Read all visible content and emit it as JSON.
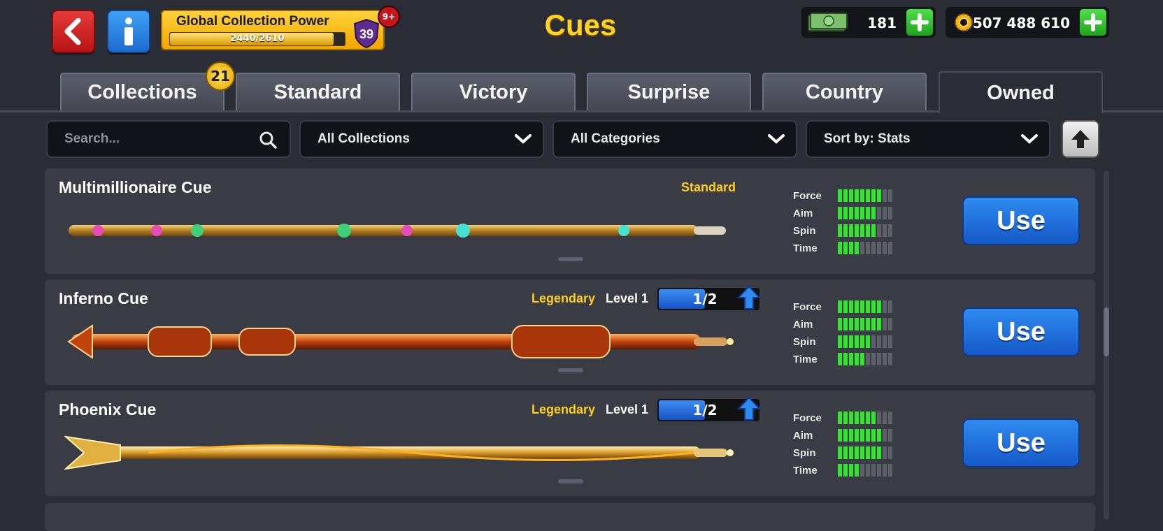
{
  "header": {
    "title": "Cues",
    "collection_power_title": "Global Collection Power",
    "collection_power_progress": "2440/2610",
    "collection_power_fraction": 0.935,
    "collection_level": "39",
    "notification_badge": "9+",
    "cash": "181",
    "coins": "507 488 610"
  },
  "tabs": [
    {
      "label": "Collections",
      "badge": "21",
      "active": false
    },
    {
      "label": "Standard",
      "active": false
    },
    {
      "label": "Victory",
      "active": false
    },
    {
      "label": "Surprise",
      "active": false
    },
    {
      "label": "Country",
      "active": false
    },
    {
      "label": "Owned",
      "active": true
    }
  ],
  "filters": {
    "search_placeholder": "Search...",
    "collections": "All Collections",
    "categories": "All Categories",
    "sort": "Sort by: Stats"
  },
  "cues": [
    {
      "name": "Multimillionaire Cue",
      "rarity": "Standard",
      "level": "",
      "level_progress": "",
      "stats": {
        "force": 8,
        "aim": 7,
        "spin": 7,
        "time": 4
      },
      "use_label": "Use"
    },
    {
      "name": "Inferno Cue",
      "rarity": "Legendary",
      "level": "Level 1",
      "level_progress": "1/2",
      "level_fraction": 0.5,
      "stats": {
        "force": 8,
        "aim": 8,
        "spin": 6,
        "time": 5
      },
      "use_label": "Use"
    },
    {
      "name": "Phoenix Cue",
      "rarity": "Legendary",
      "level": "Level 1",
      "level_progress": "1/2",
      "level_fraction": 0.5,
      "stats": {
        "force": 7,
        "aim": 8,
        "spin": 8,
        "time": 4
      },
      "use_label": "Use"
    }
  ],
  "stat_labels": {
    "force": "Force",
    "aim": "Aim",
    "spin": "Spin",
    "time": "Time"
  },
  "colors": {
    "accent": "#ffd21f",
    "rarity": "#ffcf1a",
    "stat_on": "#35e22f",
    "use_button": "#1e6fe0"
  },
  "icons": [
    "back-arrow-icon",
    "info-icon",
    "shield-icon",
    "cash-icon",
    "gear-coin-icon",
    "plus-icon",
    "search-icon",
    "chevron-down-icon",
    "arrow-up-icon"
  ]
}
